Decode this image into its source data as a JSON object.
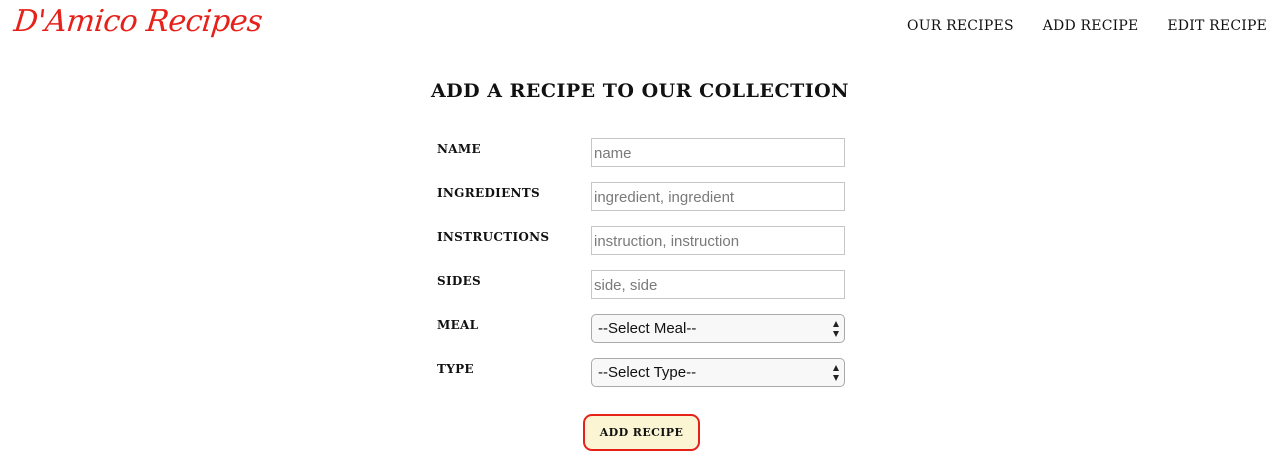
{
  "header": {
    "brand": "D'Amico Recipes",
    "nav": [
      "OUR RECIPES",
      "ADD RECIPE",
      "EDIT RECIPE"
    ]
  },
  "main": {
    "title": "ADD A RECIPE TO OUR COLLECTION",
    "fields": {
      "name": {
        "label": "NAME",
        "placeholder": "name",
        "value": ""
      },
      "ingredients": {
        "label": "INGREDIENTS",
        "placeholder": "ingredient, ingredient",
        "value": ""
      },
      "instructions": {
        "label": "INSTRUCTIONS",
        "placeholder": "instruction, instruction",
        "value": ""
      },
      "sides": {
        "label": "SIDES",
        "placeholder": "side, side",
        "value": ""
      },
      "meal": {
        "label": "MEAL",
        "selected": "--Select Meal--"
      },
      "type": {
        "label": "TYPE",
        "selected": "--Select Type--"
      }
    },
    "submit_label": "ADD RECIPE"
  },
  "colors": {
    "accent": "#e5211a",
    "button_bg": "#fbf5d3"
  }
}
